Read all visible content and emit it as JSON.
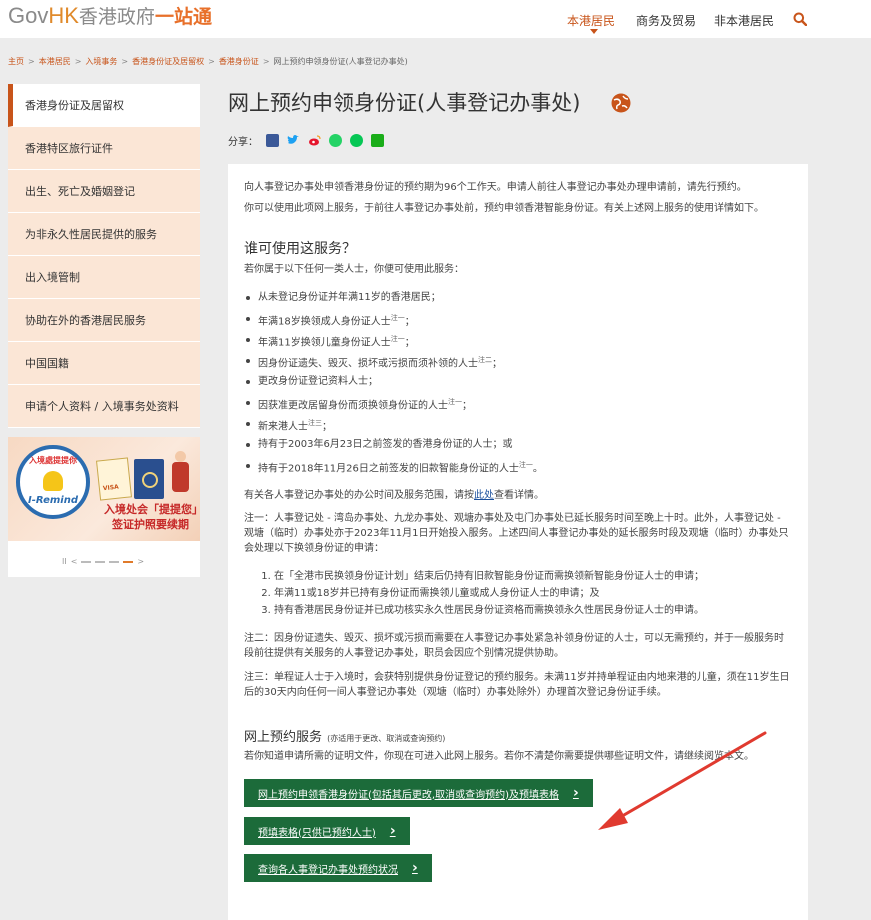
{
  "header": {
    "logo_gov": "Gov",
    "logo_hk": "HK",
    "logo_zh1": "香港政府",
    "logo_zh2": "一站通",
    "nav": [
      "本港居民",
      "商务及贸易",
      "非本港居民"
    ]
  },
  "breadcrumb": [
    "主页",
    "本港居民",
    "入境事务",
    "香港身份证及居留权",
    "香港身份证",
    "网上预约申领身份证(人事登记办事处)"
  ],
  "sidebar": {
    "items": [
      {
        "label": "香港身份证及居留权"
      },
      {
        "label": "香港特区旅行证件"
      },
      {
        "label": "出生、死亡及婚姻登记"
      },
      {
        "label": "为非永久性居民提供的服务"
      },
      {
        "label": "出入境管制"
      },
      {
        "label": "协助在外的香港居民服务"
      },
      {
        "label": "中国国籍"
      },
      {
        "label": "申请个人资料 / 入境事务处资料"
      }
    ]
  },
  "banner": {
    "badge_top": "入境處提提你",
    "badge_word": "I-Remind",
    "visa_label": "VISA",
    "line1": "入境处会「提提您」",
    "line2": "签证护照要续期"
  },
  "main": {
    "title": "网上预约申领身份证(人事登记办事处)",
    "share_label": "分享：",
    "intro1": "向人事登记办事处申领香港身份证的预约期为96个工作天。申请人前往人事登记办事处办理申请前，请先行预约。",
    "intro2": "你可以使用此项网上服务，于前往人事登记办事处前，预约申领香港智能身份证。有关上述网上服务的使用详情如下。",
    "who_heading": "谁可使用这服务？",
    "who_intro": "若你属于以下任何一类人士，你便可使用此服务：",
    "who_list": [
      {
        "text": "从未登记身份证并年满11岁的香港居民；",
        "sup": ""
      },
      {
        "text": "年满18岁换领成人身份证人士",
        "sup": "注一",
        "tail": "；"
      },
      {
        "text": "年满11岁换领儿童身份证人士",
        "sup": "注一",
        "tail": "；"
      },
      {
        "text": "因身份证遗失、毁灭、损坏或污损而须补领的人士",
        "sup": "注二",
        "tail": "；"
      },
      {
        "text": "更改身份证登记资料人士；",
        "sup": ""
      },
      {
        "text": "因获准更改居留身份而须换领身份证的人士",
        "sup": "注一",
        "tail": "；"
      },
      {
        "text": "新来港人士",
        "sup": "注三",
        "tail": "；"
      },
      {
        "text": "持有于2003年6月23日之前签发的香港身份证的人士；或",
        "sup": ""
      },
      {
        "text": "持有于2018年11月26日之前签发的旧款智能身份证的人士",
        "sup": "注一",
        "tail": "。"
      }
    ],
    "office_text_a": "有关各人事登记办事处的办公时间及服务范围，请按",
    "office_link": "此处",
    "office_text_b": "查看详情。",
    "note1": "注一：人事登记处 - 湾岛办事处、九龙办事处、观塘办事处及屯门办事处已延长服务时间至晚上十时。此外，人事登记处 - 观塘（临时）办事处亦于2023年11月1日开始投入服务。上述四间人事登记办事处的延长服务时段及观塘（临时）办事处只会处理以下换领身份证的申请：",
    "note1_list": [
      "在「全港市民换领身份证计划」结束后仍持有旧款智能身份证而需换领新智能身份证人士的申请；",
      "年满11或18岁并已持有身份证而需换领儿童或成人身份证人士的申请；及",
      "持有香港居民身份证并已成功核实永久性居民身份证资格而需换领永久性居民身份证人士的申请。"
    ],
    "note2": "注二：因身份证遗失、毁灭、损坏或污损而需要在人事登记办事处紧急补领身份证的人士，可以无需预约，并于一般服务时段前往提供有关服务的人事登记办事处，职员会因应个别情况提供协助。",
    "note3": "注三：单程证人士于入境时，会获特别提供身份证登记的预约服务。未满11岁并持单程证由内地来港的儿童，须在11岁生日后的30天内向任何一间人事登记办事处（观塘（临时）办事处除外）办理首次登记身份证手续。",
    "online_heading": "网上预约服务",
    "online_heading_small": "(亦适用于更改、取消或查询预约)",
    "online_intro": "若你知道申请所需的证明文件，你现在可进入此网上服务。若你不清楚你需要提供哪些证明文件，请继续阅览本文。",
    "buttons": [
      "网上预约申领香港身份证(包括其后更改,取消或查询预约)及预填表格",
      "预填表格(只供已预约人士)",
      "查询各人事登记办事处预约状况"
    ]
  },
  "colors": {
    "accent": "#c8541a",
    "button": "#1c6b3a",
    "sidebar_bg": "#fbe6d6",
    "arrow": "#e03a2f"
  }
}
